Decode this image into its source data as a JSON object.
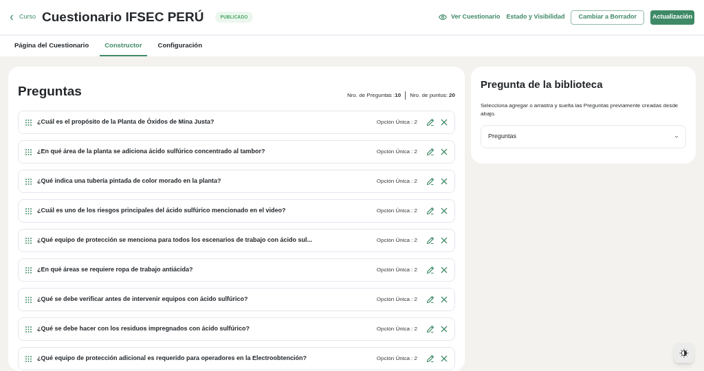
{
  "header": {
    "back_label": "Curso",
    "title": "Cuestionario IFSEC PERÚ",
    "status_badge": "PUBLICADO",
    "view_link": "Ver Cuestionario",
    "visibility_link": "Estado y Visibilidad",
    "draft_button": "Cambiar a Borrador",
    "update_button": "Actualización"
  },
  "tabs": [
    {
      "label": "Página del Cuestionario",
      "selected": false
    },
    {
      "label": "Constructor",
      "selected": true
    },
    {
      "label": "Configuración",
      "selected": false
    }
  ],
  "questions_panel": {
    "title": "Preguntas",
    "count_label": "Nro. de Preguntas :",
    "count": "10",
    "points_label": "Nro. de puntos:",
    "points": "20",
    "questions": [
      {
        "text": "¿Cuál es el propósito de la Planta de Óxidos de Mina Justa?",
        "type": "Opción Única : 2"
      },
      {
        "text": "¿En qué área de la planta se adiciona ácido sulfúrico concentrado al tambor?",
        "type": "Opción Única : 2"
      },
      {
        "text": "¿Qué indica una tubería pintada de color morado en la planta?",
        "type": "Opción Única : 2"
      },
      {
        "text": "¿Cuál es uno de los riesgos principales del ácido sulfúrico mencionado en el video?",
        "type": "Opción Única : 2"
      },
      {
        "text": "¿Qué equipo de protección se menciona para todos los escenarios de trabajo con ácido sul...",
        "type": "Opción Única : 2"
      },
      {
        "text": "¿En qué áreas se requiere ropa de trabajo antiácida?",
        "type": "Opción Única : 2"
      },
      {
        "text": "¿Qué se debe verificar antes de intervenir equipos con ácido sulfúrico?",
        "type": "Opción Única : 2"
      },
      {
        "text": "¿Qué se debe hacer con los residuos impregnados con ácido sulfúrico?",
        "type": "Opción Única : 2"
      },
      {
        "text": "¿Qué equipo de protección adicional es requerido para operadores en la Electroobtención?",
        "type": "Opción Única : 2"
      }
    ]
  },
  "library_panel": {
    "title": "Pregunta de la biblioteca",
    "description": "Selecciona agregar o arrastra y suelta las Preguntas previamente creadas desde abajo.",
    "select_value": "Preguntas"
  }
}
